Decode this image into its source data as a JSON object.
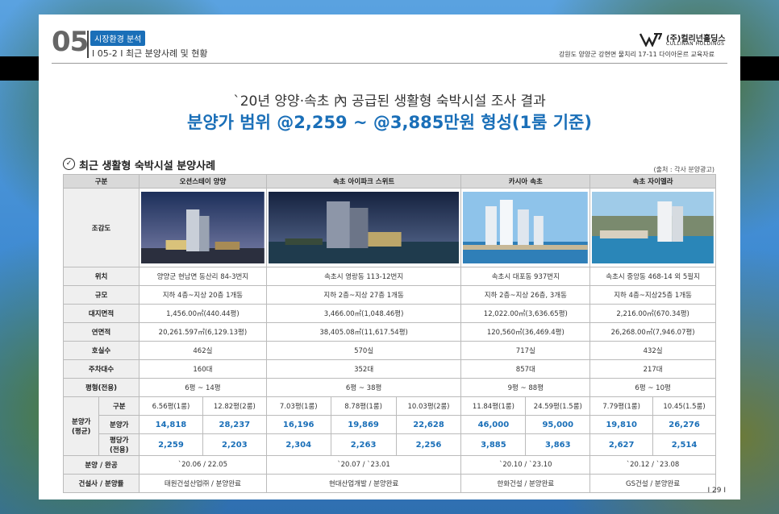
{
  "header": {
    "section_number": "05",
    "section_badge": "시장환경 분석",
    "subtitle": "I 05-2 I 최근 분양사례 및 현황",
    "company_name": "(주)컬리넌홀딩스",
    "company_eng": "CULLINAN HOLDINGS",
    "address": "강원도 양양군 강현면 물치리 17-11 다이아몬르 교육자료"
  },
  "titles": {
    "line1": "`20년 양양·속초 內 공급된 생활형 숙박시설 조사 결과",
    "line2": "분양가 범위 @2,259 ~ @3,885만원 형성(1룸 기준)"
  },
  "section": {
    "title": "최근 생활형 숙박시설 분양사례",
    "source": "(출처 : 각사 분양광고)"
  },
  "table": {
    "header_label": "구분",
    "image_row_label": "조감도",
    "projects": [
      "오션스테이 양양",
      "속초 아이파크 스위트",
      "카시아 속초",
      "속초 자이엘라"
    ],
    "rows": [
      {
        "label": "위치",
        "values": [
          "양양군 현남면 동산리 84-3번지",
          "속초시 영랑동 113-12번지",
          "속초시 대포동 937번지",
          "속초시 중앙동 468-14 외 5필지"
        ]
      },
      {
        "label": "규모",
        "values": [
          "지하 4층~지상 20층 1개동",
          "지하 2층~지상 27층 1개동",
          "지하 2층~지상 26층, 3개동",
          "지하 4층~지상25층 1개동"
        ]
      },
      {
        "label": "대지면적",
        "values": [
          "1,456.00㎡(440.44평)",
          "3,466.00㎡(1,048.46평)",
          "12,022.00㎡(3,636.65평)",
          "2,216.00㎡(670.34평)"
        ]
      },
      {
        "label": "연면적",
        "values": [
          "20,261.597㎡(6,129.13평)",
          "38,405.08㎡(11,617.54평)",
          "120,560㎡(36,469.4평)",
          "26,268.00㎡(7,946.07평)"
        ]
      },
      {
        "label": "호실수",
        "values": [
          "462실",
          "570실",
          "717실",
          "432실"
        ]
      },
      {
        "label": "주차대수",
        "values": [
          "160대",
          "352대",
          "857대",
          "217대"
        ]
      },
      {
        "label": "평형(전용)",
        "values": [
          "6평 ~ 14평",
          "6평 ~ 38평",
          "9평 ~ 88평",
          "6평 ~ 10평"
        ]
      }
    ],
    "price_group_label": "분양가\n(평균)",
    "price_sub_labels": {
      "type": "구분",
      "price": "분양가",
      "per_pyeong": "평당가\n(전용)"
    },
    "price_types": [
      "6.56평(1룸)",
      "12.82평(2룸)",
      "7.03평(1룸)",
      "8.78평(1룸)",
      "10.03평(2룸)",
      "11.84평(1룸)",
      "24.59평(1.5룸)",
      "7.79평(1룸)",
      "10.45(1.5룸)"
    ],
    "prices": [
      "14,818",
      "28,237",
      "16,196",
      "19,869",
      "22,628",
      "46,000",
      "95,000",
      "19,810",
      "26,276"
    ],
    "per_pyeong": [
      "2,259",
      "2,203",
      "2,304",
      "2,263",
      "2,256",
      "3,885",
      "3,863",
      "2,627",
      "2,514"
    ],
    "bottom_rows": [
      {
        "label": "분양 / 완공",
        "values": [
          "`20.06 / 22.05",
          "`20.07 / `23.01",
          "`20.10 / `23.10",
          "`20.12 / `23.08"
        ]
      },
      {
        "label": "건설사 / 분양률",
        "values": [
          "태원건설산업㈜ / 분양완료",
          "현대산업개발 / 분양완료",
          "한화건설 / 분양완료",
          "GS건설 / 분양완료"
        ]
      }
    ]
  },
  "page_number": "I 29 I"
}
